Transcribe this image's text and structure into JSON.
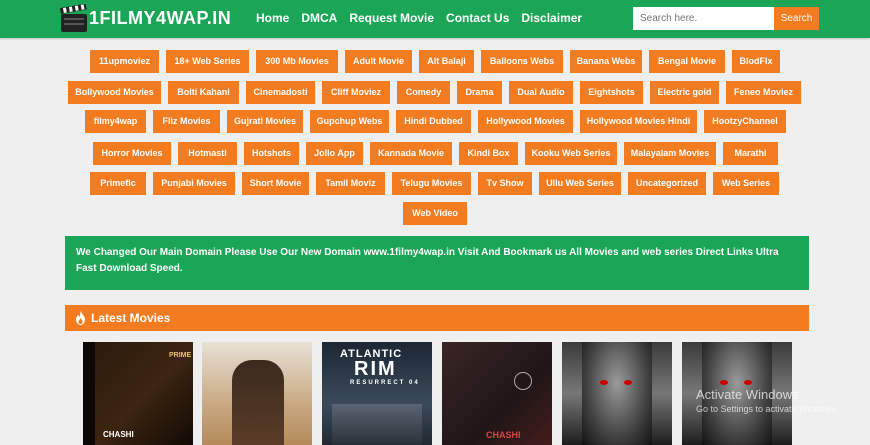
{
  "site": {
    "logo_text": "1FILMY4WAP.IN"
  },
  "nav": [
    "Home",
    "DMCA",
    "Request Movie",
    "Contact Us",
    "Disclaimer"
  ],
  "search": {
    "placeholder": "Search here.",
    "button": "Search"
  },
  "categories": [
    "11upmoviez",
    "18+ Web Series",
    "300 Mb Movies",
    "Adult Movie",
    "Alt Balaji",
    "Balloons Webs",
    "Banana Webs",
    "Bengal Movie",
    "BlodFlx",
    "Bollywood Movies",
    "Bolti Kahani",
    "Cinemadosti",
    "Cliff Moviez",
    "Comedy",
    "Drama",
    "Dual Audio",
    "Eightshots",
    "Electric goid",
    "Feneo Moviez",
    "filmy4wap",
    "Fliz Movies",
    "Gujrati Movies",
    "Gupchup Webs",
    "Hindi Dubbed",
    "Hollywood Movies",
    "Hollywood Movies Hindi",
    "HootzyChannel",
    "Horror Movies",
    "Hotmasti",
    "Hotshots",
    "Jollo App",
    "Kannada Movie",
    "Kindi Box",
    "Kooku Web Series",
    "Malayalam Movies",
    "Marathi",
    "Primeflc",
    "Punjabi Movies",
    "Short Movie",
    "Tamil Moviz",
    "Telugu Movies",
    "Tv Show",
    "Ullu Web Series",
    "Uncategorized",
    "Web Series",
    "Web Video"
  ],
  "notice": "We Changed Our Main Domain Please Use Our New Domain www.1filmy4wap.in Visit And Bookmark us All Movies and web series Direct Links Ultra Fast Download Speed.",
  "latest": {
    "title": "Latest Movies"
  },
  "posters": [
    {
      "text_top": "PRIME",
      "text_bottom": "CHASHI"
    },
    {
      "text_top": "",
      "text_bottom": ""
    },
    {
      "text_top": "ATLANTIC",
      "text_mid": "RIM",
      "text_bottom": "RESURRECT 04"
    },
    {
      "text_top": "",
      "text_bottom": "CHASHI"
    },
    {
      "text_top": "",
      "text_bottom": ""
    },
    {
      "text_top": "",
      "text_bottom": ""
    }
  ],
  "watermark": {
    "line1": "Activate Windows",
    "line2": "Go to Settings to activate Windows."
  },
  "colors": {
    "header_green": "#1aa557",
    "accent_orange": "#f47c20",
    "page_bg": "#efefef"
  }
}
